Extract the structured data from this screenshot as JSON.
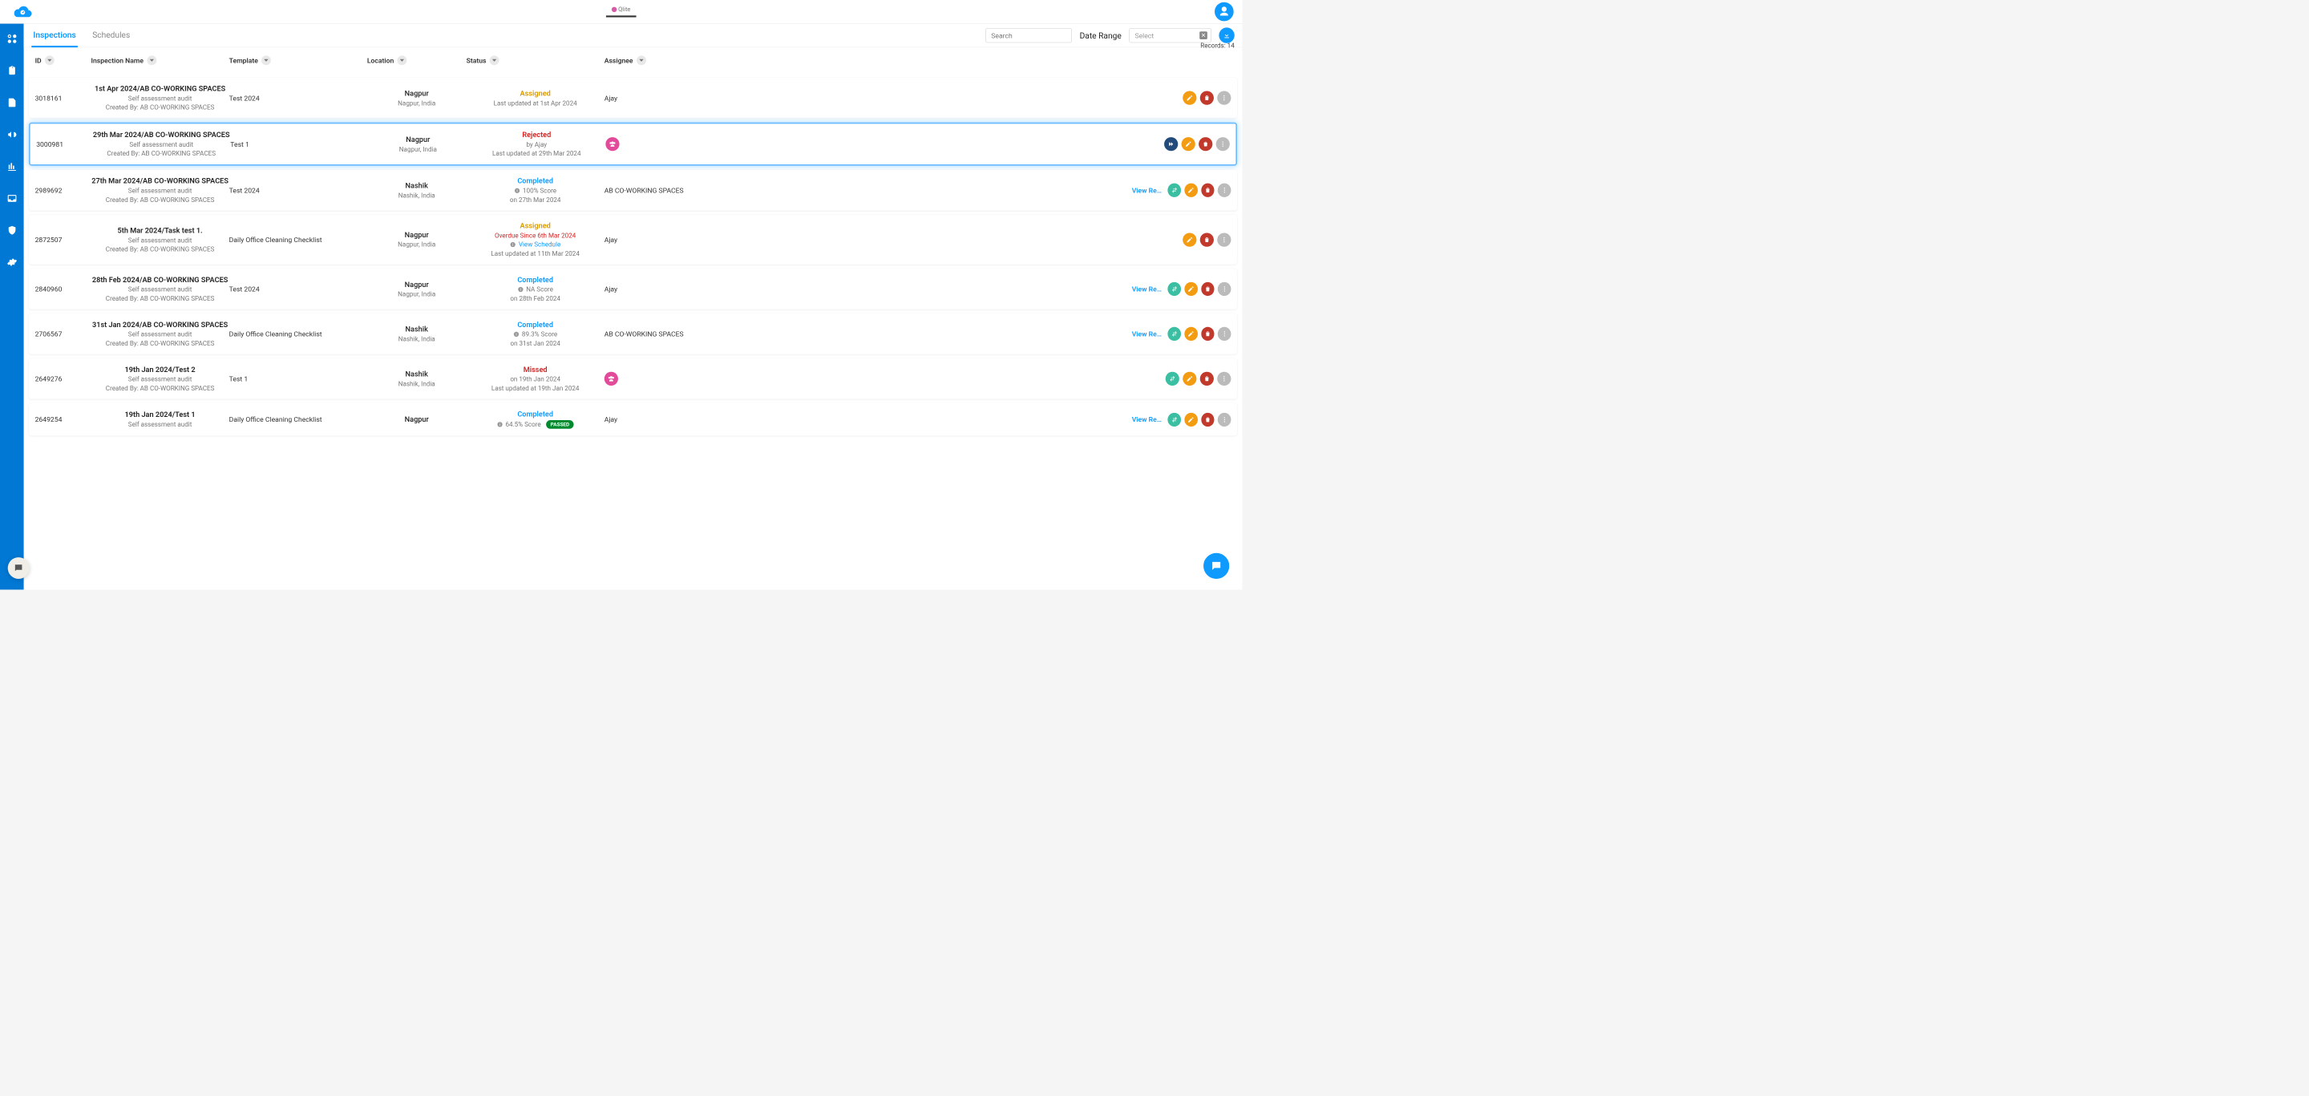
{
  "header": {
    "brand_label": "Qlite"
  },
  "tabs": {
    "inspections": "Inspections",
    "schedules": "Schedules"
  },
  "toolbar": {
    "search_placeholder": "Search",
    "date_range_label": "Date Range",
    "date_range_placeholder": "Select",
    "records_label": "Records: 14"
  },
  "columns": {
    "id": "ID",
    "name": "Inspection Name",
    "template": "Template",
    "location": "Location",
    "status": "Status",
    "assignee": "Assignee"
  },
  "labels": {
    "view_report": "View Re…"
  },
  "rows": [
    {
      "id": "3018161",
      "name": "1st Apr 2024/AB CO-WORKING SPACES",
      "sub1": "Self assessment audit",
      "sub2": "Created By: AB CO-WORKING SPACES",
      "template": "Test 2024",
      "loc_city": "Nagpur",
      "loc_sub": "Nagpur, India",
      "status_class": "st-assigned",
      "status_text": "Assigned",
      "status_line2": "Last updated at 1st Apr 2024",
      "assignee_text": "Ajay",
      "actions": [
        "edit",
        "del",
        "more"
      ]
    },
    {
      "id": "3000981",
      "highlight": true,
      "name": "29th Mar 2024/AB CO-WORKING SPACES",
      "sub1": "Self assessment audit",
      "sub2": "Created By: AB CO-WORKING SPACES",
      "template": "Test 1",
      "loc_city": "Nagpur",
      "loc_sub": "Nagpur, India",
      "status_class": "st-rejected",
      "status_text": "Rejected",
      "status_line2": "by Ajay",
      "status_line3": "Last updated at 29th Mar 2024",
      "assignee_group": true,
      "actions": [
        "fwd",
        "edit",
        "del",
        "more"
      ]
    },
    {
      "id": "2989692",
      "name": "27th Mar 2024/AB CO-WORKING SPACES",
      "sub1": "Self assessment audit",
      "sub2": "Created By: AB CO-WORKING SPACES",
      "template": "Test 2024",
      "loc_city": "Nashik",
      "loc_sub": "Nashik, India",
      "status_class": "st-completed",
      "status_text": "Completed",
      "status_score": "100%  Score",
      "status_line2": "on 27th Mar 2024",
      "assignee_text": "AB CO-WORKING SPACES",
      "view_report": true,
      "actions": [
        "swap",
        "edit",
        "del",
        "more"
      ]
    },
    {
      "id": "2872507",
      "name": "5th Mar 2024/Task test 1.",
      "sub1": "Self assessment audit",
      "sub2": "Created By: AB CO-WORKING SPACES",
      "template": "Daily Office Cleaning Checklist",
      "loc_city": "Nagpur",
      "loc_sub": "Nagpur, India",
      "status_class": "st-assigned",
      "status_text": "Assigned",
      "overdue": "Overdue Since 6th Mar 2024",
      "view_schedule": "View Schedule",
      "status_line2": "Last updated at 11th Mar 2024",
      "assignee_text": "Ajay",
      "actions": [
        "edit",
        "del",
        "more"
      ]
    },
    {
      "id": "2840960",
      "name": "28th Feb 2024/AB CO-WORKING SPACES",
      "sub1": "Self assessment audit",
      "sub2": "Created By: AB CO-WORKING SPACES",
      "template": "Test 2024",
      "loc_city": "Nagpur",
      "loc_sub": "Nagpur, India",
      "status_class": "st-completed",
      "status_text": "Completed",
      "status_score": "NA  Score",
      "status_line2": "on 28th Feb 2024",
      "assignee_text": "Ajay",
      "view_report": true,
      "actions": [
        "swap",
        "edit",
        "del",
        "more"
      ]
    },
    {
      "id": "2706567",
      "name": "31st Jan 2024/AB CO-WORKING SPACES",
      "sub1": "Self assessment audit",
      "sub2": "Created By: AB CO-WORKING SPACES",
      "template": "Daily Office Cleaning Checklist",
      "loc_city": "Nashik",
      "loc_sub": "Nashik, India",
      "status_class": "st-completed",
      "status_text": "Completed",
      "status_score": "89.3%  Score",
      "status_line2": "on 31st Jan 2024",
      "assignee_text": "AB CO-WORKING SPACES",
      "view_report": true,
      "actions": [
        "swap",
        "edit",
        "del",
        "more"
      ]
    },
    {
      "id": "2649276",
      "name": "19th Jan 2024/Test 2",
      "sub1": "Self assessment audit",
      "sub2": "Created By: AB CO-WORKING SPACES",
      "template": "Test 1",
      "loc_city": "Nashik",
      "loc_sub": "Nashik, India",
      "status_class": "st-missed",
      "status_text": "Missed",
      "status_line2": "on 19th Jan 2024",
      "status_line3": "Last updated at 19th Jan 2024",
      "assignee_group": true,
      "actions": [
        "swap",
        "edit",
        "del",
        "more"
      ]
    },
    {
      "id": "2649254",
      "name": "19th Jan 2024/Test 1",
      "sub1": "Self assessment audit",
      "sub2": "",
      "template": "Daily Office Cleaning Checklist",
      "loc_city": "Nagpur",
      "loc_sub": "",
      "status_class": "st-completed",
      "status_text": "Completed",
      "status_score": "64.5% Score",
      "passed": "PASSED",
      "assignee_text": "Ajay",
      "view_report": true,
      "actions": [
        "swap",
        "edit",
        "del",
        "more"
      ]
    }
  ]
}
